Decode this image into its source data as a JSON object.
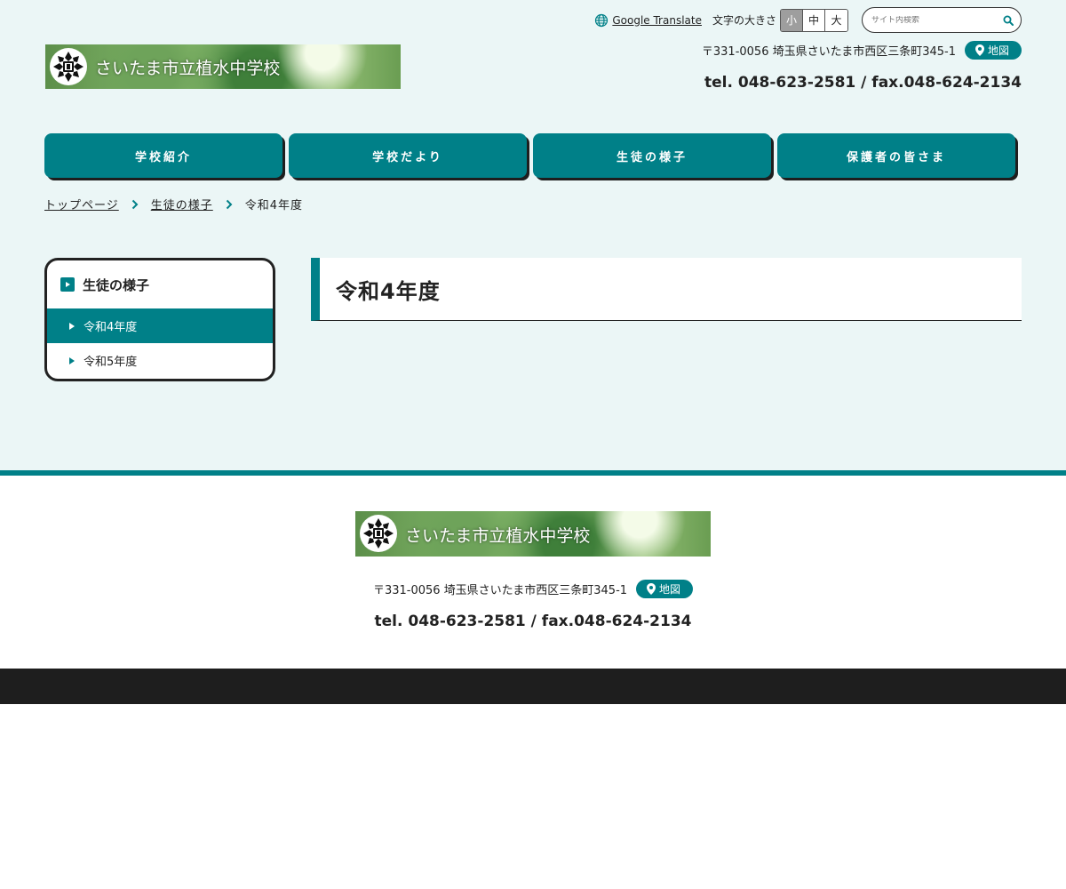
{
  "header": {
    "translate_label": "Google Translate",
    "fontsize_label": "文字の大きさ",
    "fontsize_options": [
      "小",
      "中",
      "大"
    ],
    "fontsize_selected": "小",
    "search_placeholder": "サイト内検索",
    "logo_text": "さいたま市立植水中学校",
    "address": "〒331-0056 埼玉県さいたま市西区三条町345-1",
    "map_label": "地図",
    "tel": "tel. 048-623-2581 / fax.048-624-2134"
  },
  "nav": {
    "items": [
      {
        "label": "学校紹介"
      },
      {
        "label": "学校だより"
      },
      {
        "label": "生徒の様子"
      },
      {
        "label": "保護者の皆さま"
      }
    ]
  },
  "breadcrumb": {
    "items": [
      {
        "label": "トップページ"
      },
      {
        "label": "生徒の様子"
      }
    ],
    "current": "令和4年度"
  },
  "sidenav": {
    "title": "生徒の様子",
    "items": [
      {
        "label": "令和4年度",
        "active": true
      },
      {
        "label": "令和5年度",
        "active": false
      }
    ]
  },
  "main": {
    "title": "令和4年度"
  },
  "footer": {
    "logo_text": "さいたま市立植水中学校",
    "address": "〒331-0056 埼玉県さいたま市西区三条町345-1",
    "map_label": "地図",
    "tel": "tel. 048-623-2581 / fax.048-624-2134"
  },
  "colors": {
    "accent": "#008088",
    "background": "#ebf6f6",
    "dark": "#1e1e1e"
  },
  "icons": {
    "translate": "globe-icon",
    "search": "search-icon",
    "map": "map-pin-icon",
    "breadcrumb_sep": "chevron-right-icon",
    "crest": "school-crest-icon"
  }
}
